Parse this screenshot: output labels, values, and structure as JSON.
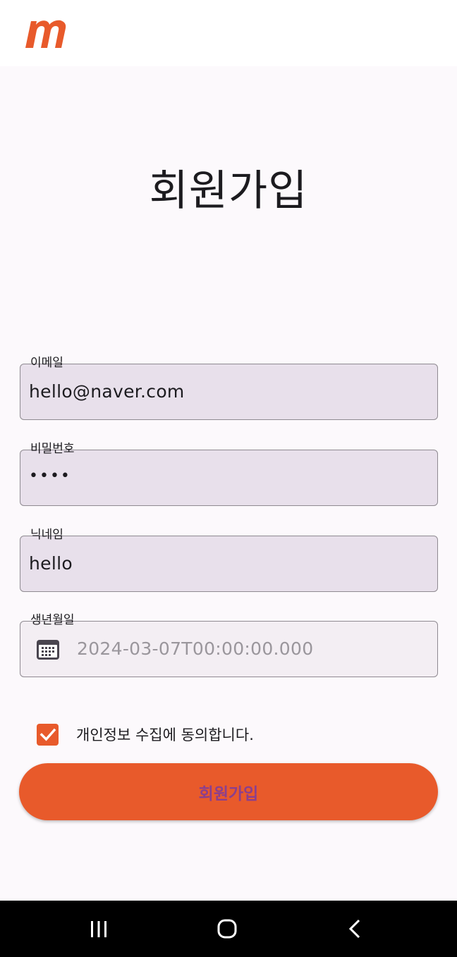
{
  "app_bar": {
    "logo_icon": "m-logo-icon",
    "brand_color": "#e85a2b"
  },
  "page": {
    "title": "회원가입"
  },
  "form": {
    "email": {
      "label": "이메일",
      "value": "hello@naver.com"
    },
    "password": {
      "label": "비밀번호",
      "value": "••••"
    },
    "nickname": {
      "label": "닉네임",
      "value": "hello"
    },
    "birthdate": {
      "label": "생년월일",
      "placeholder": "2024-03-07T00:00:00.000",
      "icon": "calendar-icon"
    },
    "consent": {
      "label": "개인정보 수집에 동의합니다.",
      "checked": true
    },
    "submit_label": "회원가입"
  },
  "nav_bar": {
    "recents_icon": "recents-icon",
    "home_icon": "home-icon",
    "back_icon": "back-icon"
  }
}
